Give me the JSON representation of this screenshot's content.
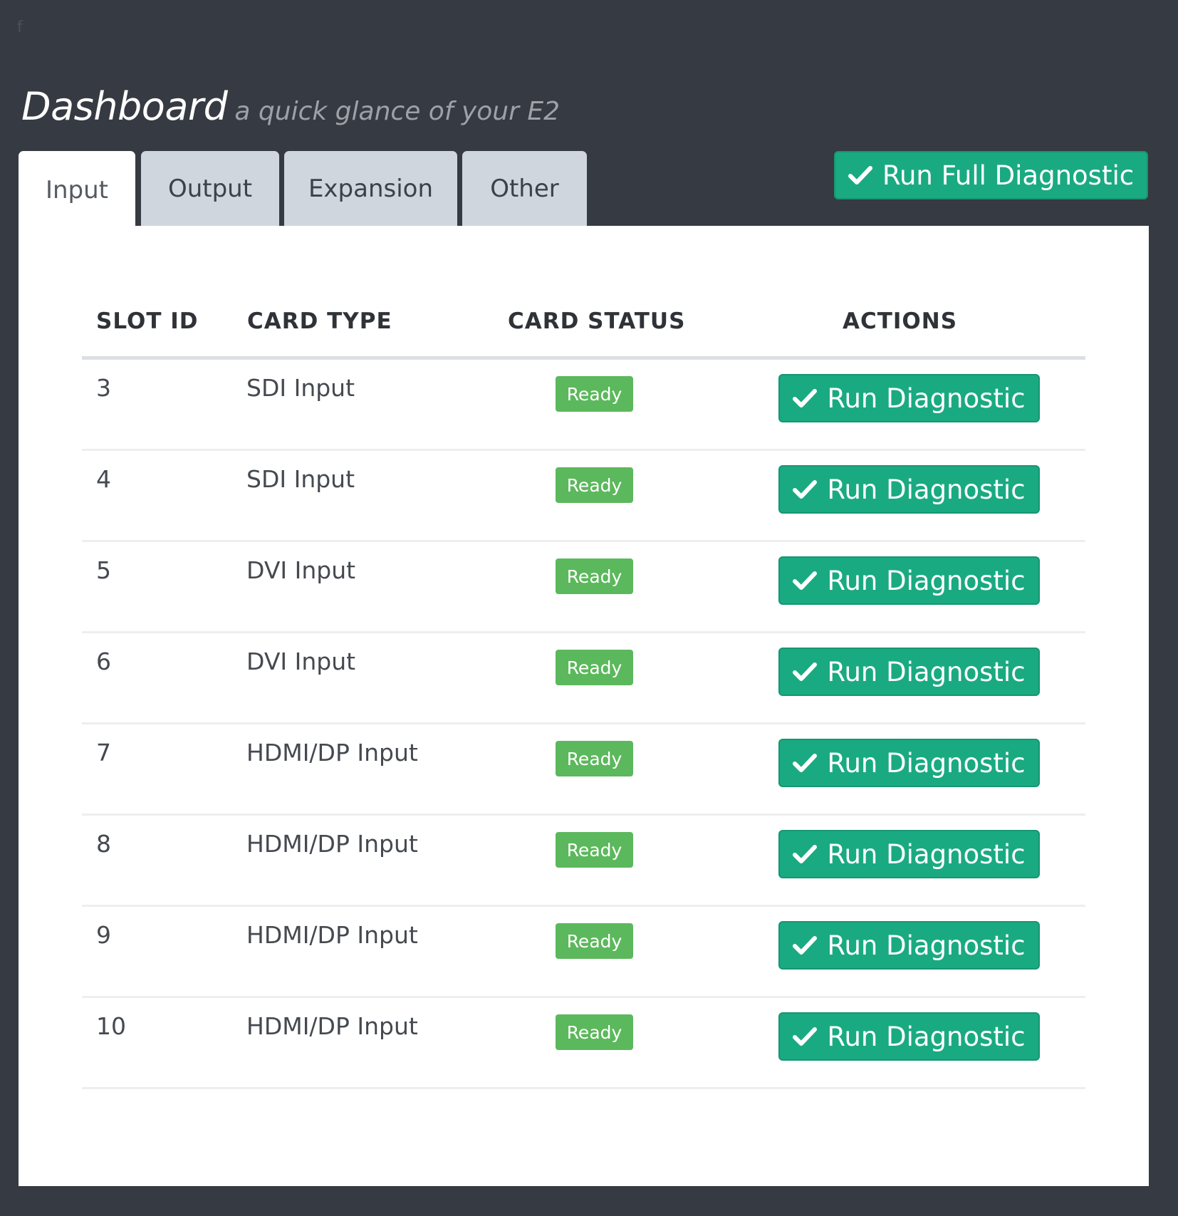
{
  "header": {
    "corner_glyph": "f",
    "title": "Dashboard",
    "subtitle": "a quick glance of your E2"
  },
  "tabs": [
    {
      "label": "Input",
      "active": true
    },
    {
      "label": "Output",
      "active": false
    },
    {
      "label": "Expansion",
      "active": false
    },
    {
      "label": "Other",
      "active": false
    }
  ],
  "toolbar": {
    "full_diagnostic_label": "Run Full Diagnostic",
    "icon": "check-icon"
  },
  "table": {
    "columns": [
      "SLOT ID",
      "CARD TYPE",
      "CARD STATUS",
      "ACTIONS"
    ],
    "action_label": "Run Diagnostic",
    "rows": [
      {
        "slot": "3",
        "type": "SDI Input",
        "status": "Ready"
      },
      {
        "slot": "4",
        "type": "SDI Input",
        "status": "Ready"
      },
      {
        "slot": "5",
        "type": "DVI Input",
        "status": "Ready"
      },
      {
        "slot": "6",
        "type": "DVI Input",
        "status": "Ready"
      },
      {
        "slot": "7",
        "type": "HDMI/DP Input",
        "status": "Ready"
      },
      {
        "slot": "8",
        "type": "HDMI/DP Input",
        "status": "Ready"
      },
      {
        "slot": "9",
        "type": "HDMI/DP Input",
        "status": "Ready"
      },
      {
        "slot": "10",
        "type": "HDMI/DP Input",
        "status": "Ready"
      }
    ]
  },
  "colors": {
    "background": "#363a42",
    "accent_button": "#1aaa82",
    "status_ready": "#5cb85c",
    "tab_inactive": "#cfd6dd"
  }
}
